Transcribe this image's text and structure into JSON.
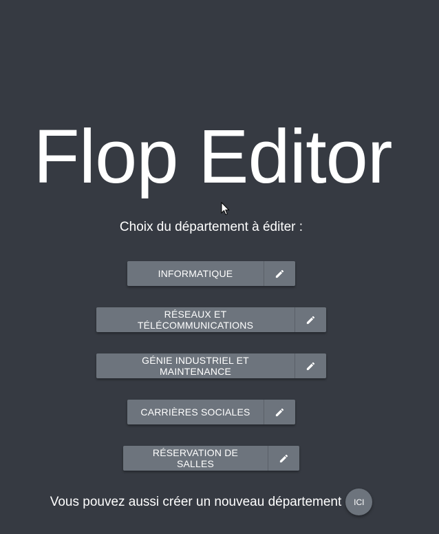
{
  "title": "Flop Editor",
  "subtitle": "Choix du département à éditer :",
  "departments": [
    {
      "label": "INFORMATIQUE",
      "edit_icon": "pencil-icon"
    },
    {
      "label": "RÉSEAUX ET TÉLÉCOMMUNICATIONS",
      "edit_icon": "pencil-icon"
    },
    {
      "label": "GÉNIE INDUSTRIEL ET MAINTENANCE",
      "edit_icon": "pencil-icon"
    },
    {
      "label": "CARRIÈRES SOCIALES",
      "edit_icon": "pencil-icon"
    },
    {
      "label": "RÉSERVATION DE SALLES",
      "edit_icon": "pencil-icon"
    }
  ],
  "footer": {
    "text": "Vous pouvez aussi créer un nouveau département",
    "button_label": "ICI"
  },
  "colors": {
    "background": "#363a42",
    "button": "#6d747d",
    "text": "#ffffff"
  }
}
